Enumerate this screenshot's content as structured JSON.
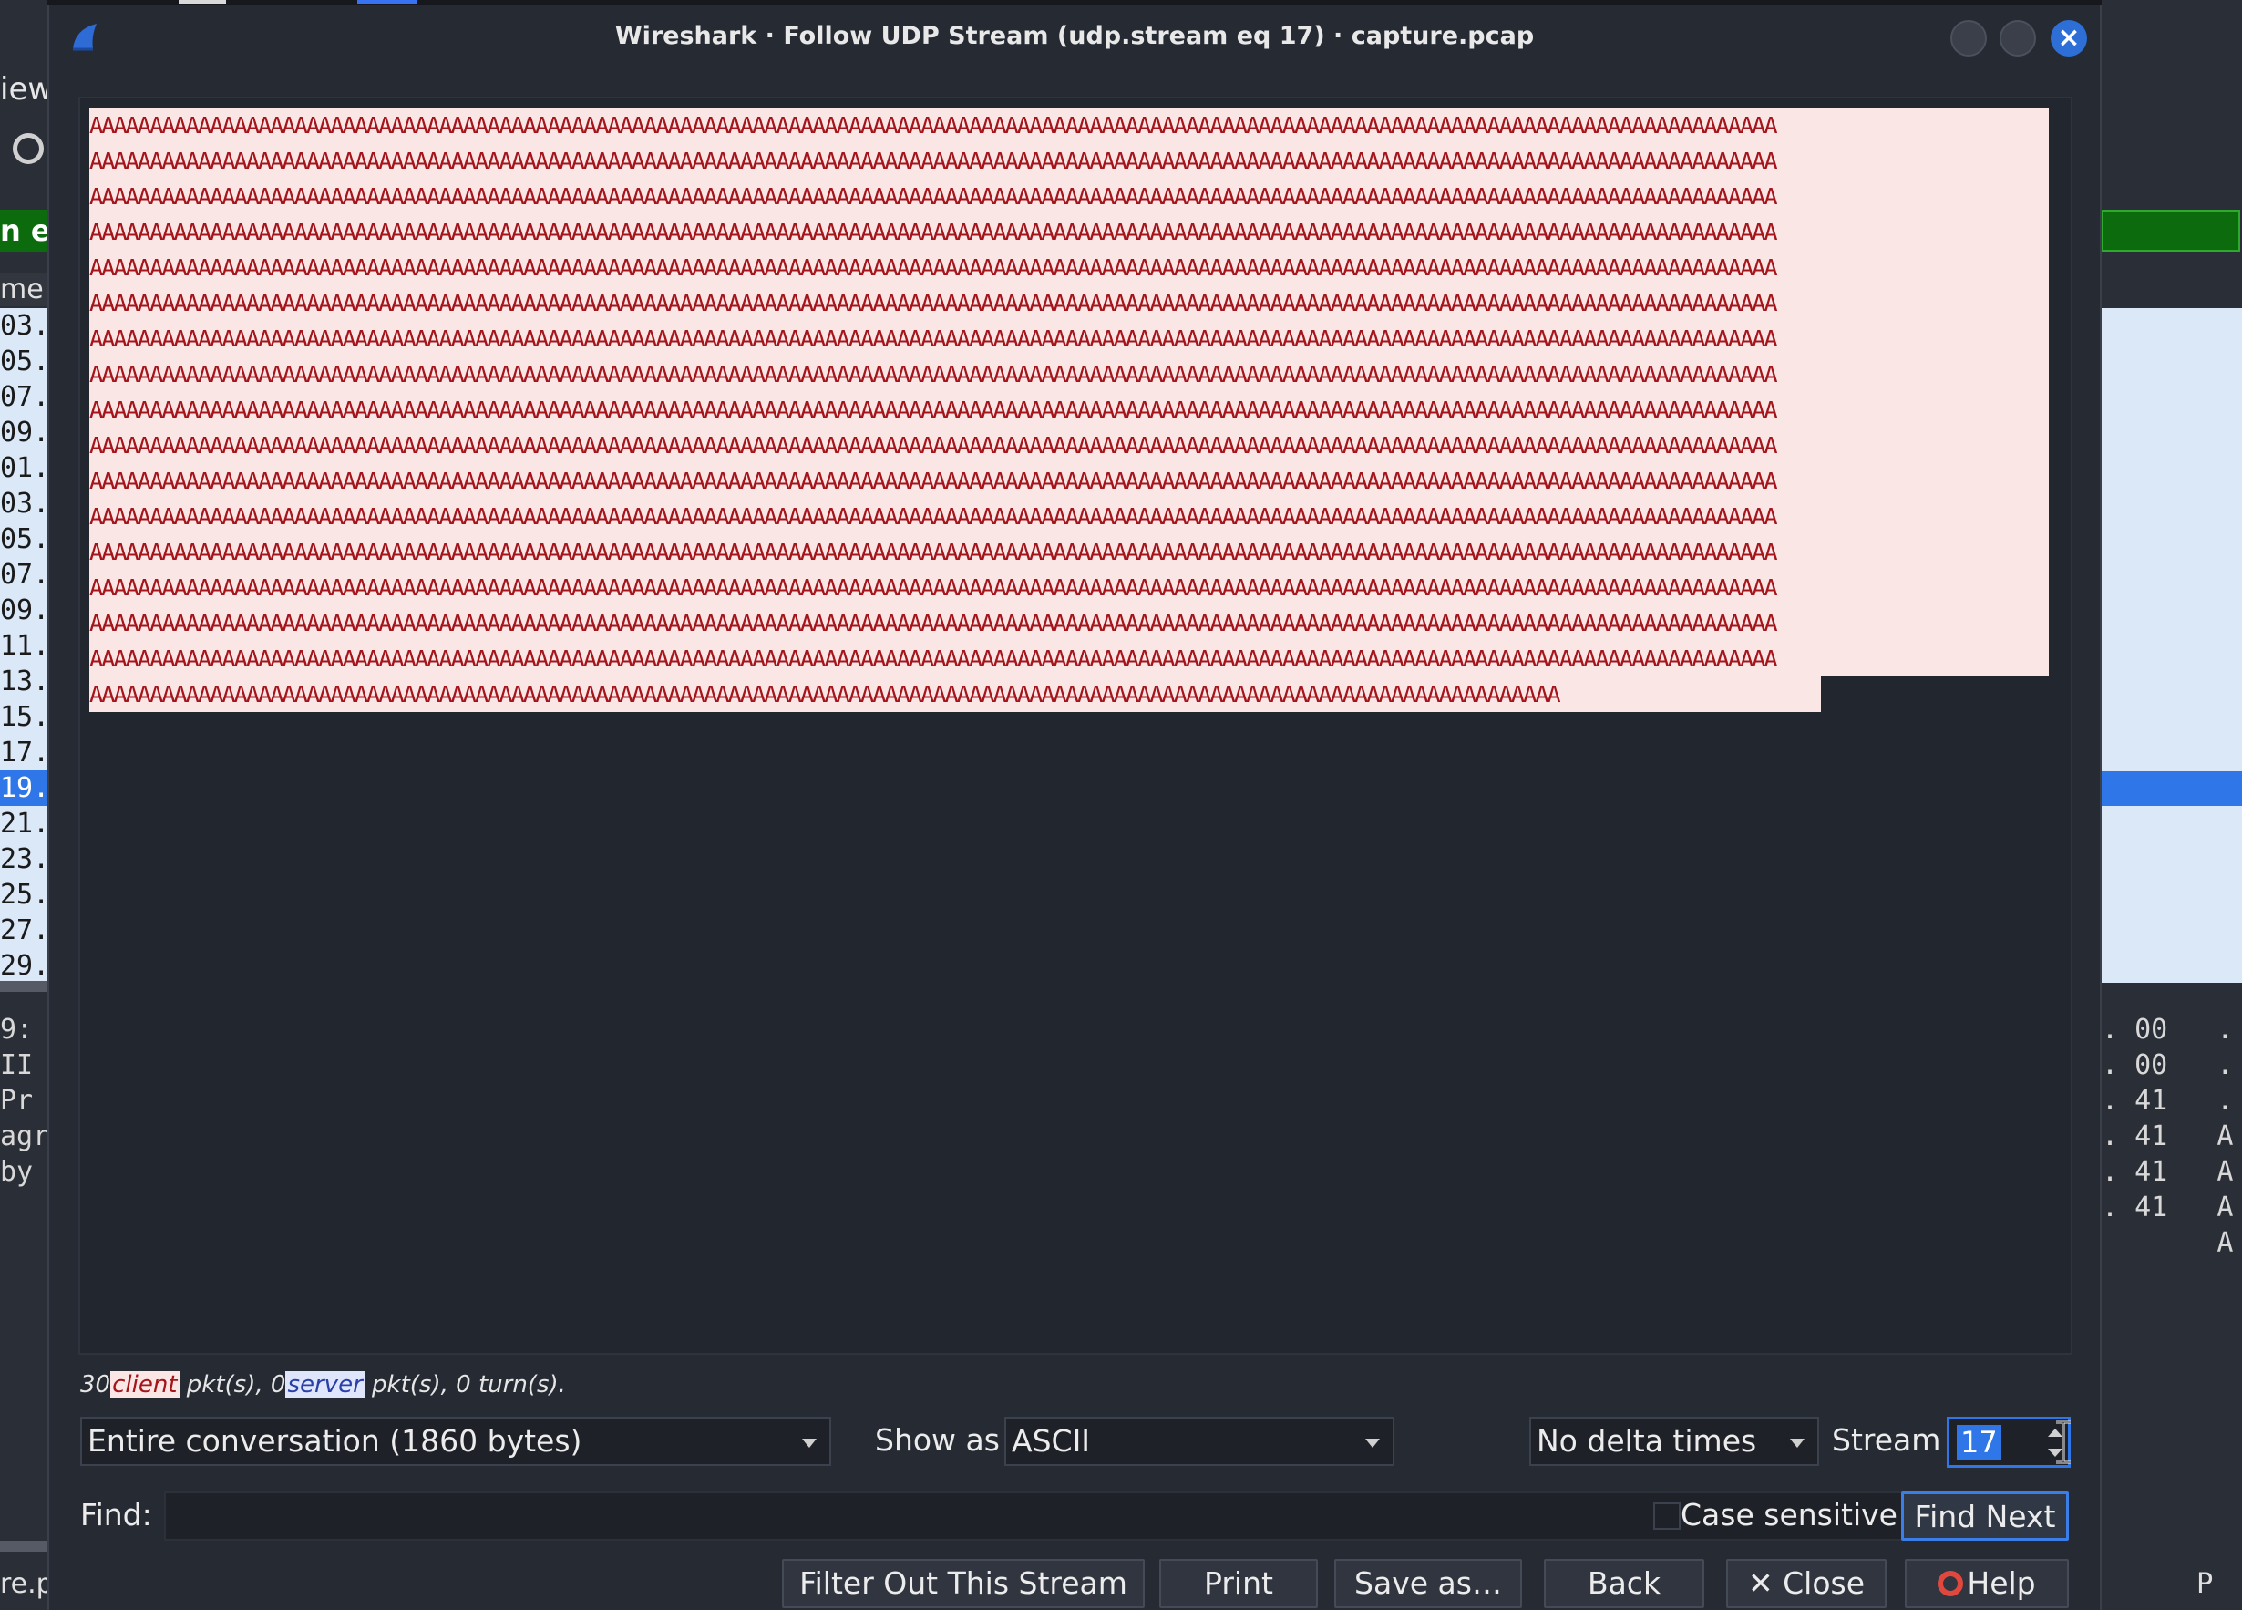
{
  "background": {
    "menu_fragment": "iew",
    "filter_fragment": "n eq",
    "column_header_fragment": "me",
    "row_fragments": [
      "03.",
      "05.",
      "07.",
      "09.",
      "01.",
      "03.",
      "05.",
      "07.",
      "09.",
      "11.",
      "13.",
      "15.",
      "17.",
      "19.",
      "21.",
      "23.",
      "25.",
      "27.",
      "29."
    ],
    "selected_row_index": 13,
    "hex_left": [
      "9:",
      " II",
      " Pr",
      "agr",
      " by"
    ],
    "hex_right": [
      ". 00   .",
      ". 00   .",
      ". 41   .",
      ". 41   A",
      ". 41   A",
      ". 41   A",
      "       A"
    ],
    "status_left": "re.p",
    "status_right": "P"
  },
  "dialog": {
    "title": "Wireshark · Follow UDP Stream (udp.stream eq 17) · capture.pcap",
    "stream_lines": [
      "AAAAAAAAAAAAAAAAAAAAAAAAAAAAAAAAAAAAAAAAAAAAAAAAAAAAAAAAAAAAAAAAAAAAAAAAAAAAAAAAAAAAAAAAAAAAAAAAAAAAAAAAAAAAAAAAAAAAAAAAAAAAAAAAAAAAAAAAAAAA",
      "AAAAAAAAAAAAAAAAAAAAAAAAAAAAAAAAAAAAAAAAAAAAAAAAAAAAAAAAAAAAAAAAAAAAAAAAAAAAAAAAAAAAAAAAAAAAAAAAAAAAAAAAAAAAAAAAAAAAAAAAAAAAAAAAAAAAAAAAAAAA",
      "AAAAAAAAAAAAAAAAAAAAAAAAAAAAAAAAAAAAAAAAAAAAAAAAAAAAAAAAAAAAAAAAAAAAAAAAAAAAAAAAAAAAAAAAAAAAAAAAAAAAAAAAAAAAAAAAAAAAAAAAAAAAAAAAAAAAAAAAAAAA",
      "AAAAAAAAAAAAAAAAAAAAAAAAAAAAAAAAAAAAAAAAAAAAAAAAAAAAAAAAAAAAAAAAAAAAAAAAAAAAAAAAAAAAAAAAAAAAAAAAAAAAAAAAAAAAAAAAAAAAAAAAAAAAAAAAAAAAAAAAAAAA",
      "AAAAAAAAAAAAAAAAAAAAAAAAAAAAAAAAAAAAAAAAAAAAAAAAAAAAAAAAAAAAAAAAAAAAAAAAAAAAAAAAAAAAAAAAAAAAAAAAAAAAAAAAAAAAAAAAAAAAAAAAAAAAAAAAAAAAAAAAAAAA",
      "AAAAAAAAAAAAAAAAAAAAAAAAAAAAAAAAAAAAAAAAAAAAAAAAAAAAAAAAAAAAAAAAAAAAAAAAAAAAAAAAAAAAAAAAAAAAAAAAAAAAAAAAAAAAAAAAAAAAAAAAAAAAAAAAAAAAAAAAAAAA",
      "AAAAAAAAAAAAAAAAAAAAAAAAAAAAAAAAAAAAAAAAAAAAAAAAAAAAAAAAAAAAAAAAAAAAAAAAAAAAAAAAAAAAAAAAAAAAAAAAAAAAAAAAAAAAAAAAAAAAAAAAAAAAAAAAAAAAAAAAAAAA",
      "AAAAAAAAAAAAAAAAAAAAAAAAAAAAAAAAAAAAAAAAAAAAAAAAAAAAAAAAAAAAAAAAAAAAAAAAAAAAAAAAAAAAAAAAAAAAAAAAAAAAAAAAAAAAAAAAAAAAAAAAAAAAAAAAAAAAAAAAAAAA",
      "AAAAAAAAAAAAAAAAAAAAAAAAAAAAAAAAAAAAAAAAAAAAAAAAAAAAAAAAAAAAAAAAAAAAAAAAAAAAAAAAAAAAAAAAAAAAAAAAAAAAAAAAAAAAAAAAAAAAAAAAAAAAAAAAAAAAAAAAAAAA",
      "AAAAAAAAAAAAAAAAAAAAAAAAAAAAAAAAAAAAAAAAAAAAAAAAAAAAAAAAAAAAAAAAAAAAAAAAAAAAAAAAAAAAAAAAAAAAAAAAAAAAAAAAAAAAAAAAAAAAAAAAAAAAAAAAAAAAAAAAAAAA",
      "AAAAAAAAAAAAAAAAAAAAAAAAAAAAAAAAAAAAAAAAAAAAAAAAAAAAAAAAAAAAAAAAAAAAAAAAAAAAAAAAAAAAAAAAAAAAAAAAAAAAAAAAAAAAAAAAAAAAAAAAAAAAAAAAAAAAAAAAAAAA",
      "AAAAAAAAAAAAAAAAAAAAAAAAAAAAAAAAAAAAAAAAAAAAAAAAAAAAAAAAAAAAAAAAAAAAAAAAAAAAAAAAAAAAAAAAAAAAAAAAAAAAAAAAAAAAAAAAAAAAAAAAAAAAAAAAAAAAAAAAAAAA",
      "AAAAAAAAAAAAAAAAAAAAAAAAAAAAAAAAAAAAAAAAAAAAAAAAAAAAAAAAAAAAAAAAAAAAAAAAAAAAAAAAAAAAAAAAAAAAAAAAAAAAAAAAAAAAAAAAAAAAAAAAAAAAAAAAAAAAAAAAAAAA",
      "AAAAAAAAAAAAAAAAAAAAAAAAAAAAAAAAAAAAAAAAAAAAAAAAAAAAAAAAAAAAAAAAAAAAAAAAAAAAAAAAAAAAAAAAAAAAAAAAAAAAAAAAAAAAAAAAAAAAAAAAAAAAAAAAAAAAAAAAAAAA",
      "AAAAAAAAAAAAAAAAAAAAAAAAAAAAAAAAAAAAAAAAAAAAAAAAAAAAAAAAAAAAAAAAAAAAAAAAAAAAAAAAAAAAAAAAAAAAAAAAAAAAAAAAAAAAAAAAAAAAAAAAAAAAAAAAAAAAAAAAAAAA",
      "AAAAAAAAAAAAAAAAAAAAAAAAAAAAAAAAAAAAAAAAAAAAAAAAAAAAAAAAAAAAAAAAAAAAAAAAAAAAAAAAAAAAAAAAAAAAAAAAAAAAAAAAAAAAAAAAAAAAAAAAAAAAAAAAAAAAAAAAAAAA",
      "AAAAAAAAAAAAAAAAAAAAAAAAAAAAAAAAAAAAAAAAAAAAAAAAAAAAAAAAAAAAAAAAAAAAAAAAAAAAAAAAAAAAAAAAAAAAAAAAAAAAAAAAAAAAAAAAAAAAAAAAAA"
    ],
    "summary": {
      "client_count": "30",
      "client_word": "client",
      "mid": " pkt(s), 0",
      "server_word": "server",
      "tail": " pkt(s), 0 turn(s)."
    },
    "conversation_select": "Entire conversation (1860 bytes)",
    "show_as_label": "Show as",
    "show_as_select": "ASCII",
    "delta_select": "No delta times",
    "stream_label": "Stream",
    "stream_value": "17",
    "find_label": "Find:",
    "find_value": "",
    "case_sensitive_label": "Case sensitive",
    "find_next_label": "Find Next",
    "buttons": {
      "filter_out": "Filter Out This Stream",
      "print": "Print",
      "save_as": "Save as…",
      "back": "Back",
      "close": "✕ Close",
      "help": "Help"
    }
  },
  "colors": {
    "client_bg": "#fbe6e6",
    "client_fg": "#a3141b",
    "server_bg": "#dfe6fb",
    "accent": "#2f76e8",
    "filter_ok": "#0c6b0c"
  }
}
